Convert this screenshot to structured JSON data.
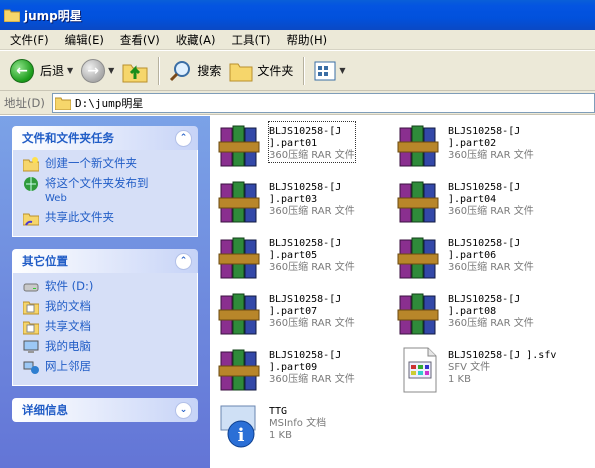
{
  "window": {
    "title": "jump明星"
  },
  "menu": [
    "文件(F)",
    "编辑(E)",
    "查看(V)",
    "收藏(A)",
    "工具(T)",
    "帮助(H)"
  ],
  "toolbar": {
    "back": "后退",
    "search": "搜索",
    "folders": "文件夹"
  },
  "address": {
    "label": "地址(D)",
    "value": "D:\\jump明星"
  },
  "tasks_panel": {
    "title": "文件和文件夹任务",
    "items": [
      {
        "label": "创建一个新文件夹",
        "sub": ""
      },
      {
        "label": "将这个文件夹发布到",
        "sub": "Web"
      },
      {
        "label": "共享此文件夹",
        "sub": ""
      }
    ]
  },
  "places_panel": {
    "title": "其它位置",
    "items": [
      {
        "label": "软件 (D:)"
      },
      {
        "label": "我的文档"
      },
      {
        "label": "共享文档"
      },
      {
        "label": "我的电脑"
      },
      {
        "label": "网上邻居"
      }
    ]
  },
  "details_panel": {
    "title": "详细信息"
  },
  "files": [
    {
      "line1": "BLJS10258-[J",
      "line2": "].part01",
      "type": "360压缩 RAR 文件",
      "icon": "rar-archive-icon"
    },
    {
      "line1": "BLJS10258-[J",
      "line2": "].part02",
      "type": "360压缩 RAR 文件",
      "icon": "rar-archive-icon"
    },
    {
      "line1": "BLJS10258-[J",
      "line2": "].part03",
      "type": "360压缩 RAR 文件",
      "icon": "rar-archive-icon"
    },
    {
      "line1": "BLJS10258-[J",
      "line2": "].part04",
      "type": "360压缩 RAR 文件",
      "icon": "rar-archive-icon"
    },
    {
      "line1": "BLJS10258-[J",
      "line2": "].part05",
      "type": "360压缩 RAR 文件",
      "icon": "rar-archive-icon"
    },
    {
      "line1": "BLJS10258-[J",
      "line2": "].part06",
      "type": "360压缩 RAR 文件",
      "icon": "rar-archive-icon"
    },
    {
      "line1": "BLJS10258-[J",
      "line2": "].part07",
      "type": "360压缩 RAR 文件",
      "icon": "rar-archive-icon"
    },
    {
      "line1": "BLJS10258-[J",
      "line2": "].part08",
      "type": "360压缩 RAR 文件",
      "icon": "rar-archive-icon"
    },
    {
      "line1": "BLJS10258-[J",
      "line2": "].part09",
      "type": "360压缩 RAR 文件",
      "icon": "rar-archive-icon"
    },
    {
      "line1": "BLJS10258-[J ].sfv",
      "line2": "SFV 文件",
      "type": "1 KB",
      "icon": "sfv-file-icon"
    },
    {
      "line1": "TTG",
      "line2": "MSInfo 文档",
      "type": "1 KB",
      "icon": "msinfo-doc-icon"
    }
  ]
}
